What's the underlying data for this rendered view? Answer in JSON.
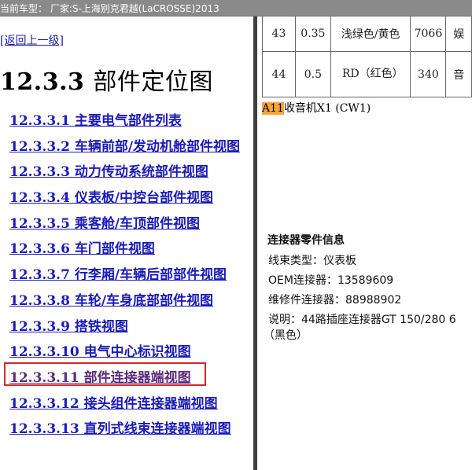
{
  "title_bar": "当前车型： 厂家:S-上海别克君越(LaCROSSE)2013",
  "left_panel": {
    "back_link": "[返回上一级]",
    "heading_num": "12.3.3",
    "heading_text": "部件定位图",
    "toc": [
      {
        "label": "12.3.3.1 主要电气部件列表"
      },
      {
        "label": "12.3.3.2 车辆前部/发动机舱部件视图"
      },
      {
        "label": "12.3.3.3 动力传动系统部件视图"
      },
      {
        "label": "12.3.3.4 仪表板/中控台部件视图"
      },
      {
        "label": "12.3.3.5 乘客舱/车顶部件视图"
      },
      {
        "label": "12.3.3.6 车门部件视图"
      },
      {
        "label": "12.3.3.7 行李厢/车辆后部部件视图"
      },
      {
        "label": "12.3.3.8 车轮/车身底部部件视图"
      },
      {
        "label": "12.3.3.9 搭铁视图"
      },
      {
        "label": "12.3.3.10 电气中心标识视图"
      },
      {
        "label": "12.3.3.11 部件连接器端视图"
      },
      {
        "label": "12.3.3.12 接头组件连接器端视图"
      },
      {
        "label": "12.3.3.13 直列式线束连接器端视图"
      }
    ]
  },
  "right_panel": {
    "table_rows": [
      [
        "43",
        "0.35",
        "浅绿色/黄色",
        "7066",
        "娱"
      ],
      [
        "44",
        "0.5",
        "RD（红色）",
        "340",
        "音"
      ]
    ],
    "component_code": "A11",
    "component_name": "收音机X1 (CW1)",
    "info_title": "连接器零件信息",
    "info_lines": [
      "线束类型：仪表板",
      "OEM连接器：13589609",
      "维修件连接器：88988902",
      "说明：44路插座连接器GT 150/280 6",
      "（黑色）"
    ]
  }
}
